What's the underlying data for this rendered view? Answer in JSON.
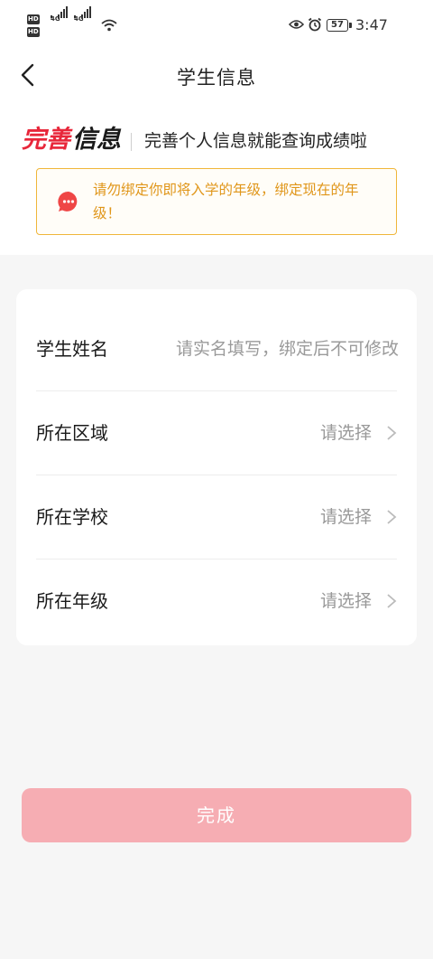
{
  "status_bar": {
    "hd1": "HD",
    "hd2": "HD",
    "net1": "4G",
    "net2": "4G",
    "battery": "57",
    "time": "3:47"
  },
  "nav": {
    "title": "学生信息"
  },
  "headline": {
    "red": "完善",
    "black": "信息",
    "subtitle": "完善个人信息就能查询成绩啦"
  },
  "notice": {
    "text": "请勿绑定你即将入学的年级，绑定现在的年级！"
  },
  "form": {
    "name": {
      "label": "学生姓名",
      "placeholder": "请实名填写，绑定后不可修改",
      "value": ""
    },
    "region": {
      "label": "所在区域",
      "value": "请选择"
    },
    "school": {
      "label": "所在学校",
      "value": "请选择"
    },
    "grade": {
      "label": "所在年级",
      "value": "请选择"
    }
  },
  "submit": {
    "label": "完成"
  },
  "colors": {
    "accent_red": "#e8263a",
    "notice_border": "#f0b63a",
    "notice_text": "#e0961a",
    "submit_bg": "#f6adb3"
  },
  "icons": [
    "back-arrow-icon",
    "eye-icon",
    "alarm-icon",
    "wifi-icon",
    "chat-bubble-icon",
    "chevron-right-icon"
  ]
}
